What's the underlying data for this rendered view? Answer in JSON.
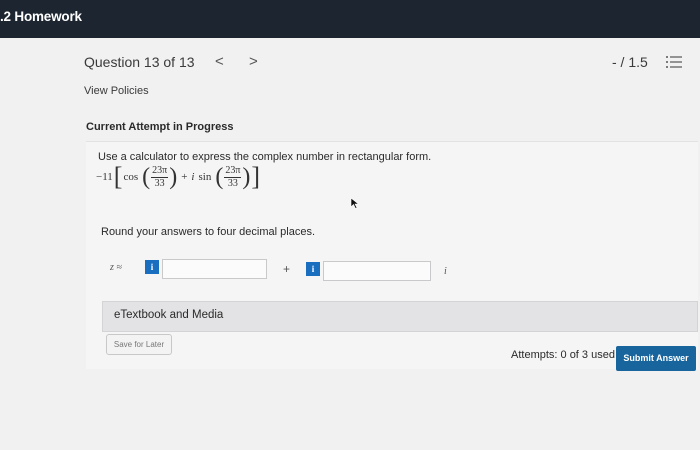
{
  "app": {
    "title": ".2 Homework"
  },
  "question_header": {
    "title": "Question 13 of 13",
    "prev_icon": "chevron-left-icon",
    "next_icon": "chevron-right-icon",
    "prev_glyph": "<",
    "next_glyph": ">",
    "score": "- / 1.5",
    "list_icon": "list-icon"
  },
  "links": {
    "view_policies": "View Policies"
  },
  "attempt": {
    "title": "Current Attempt in Progress"
  },
  "question": {
    "instruction": "Use a calculator to express the complex number in rectangular form.",
    "formula": {
      "coefficient": "−11",
      "open_bracket": "[",
      "close_bracket": "]",
      "cos": "cos",
      "sin": "sin",
      "plus": "+",
      "imag_unit": "i",
      "open_paren": "(",
      "close_paren": ")",
      "numerator": "23π",
      "denominator": "33"
    },
    "round_text": "Round your answers to four decimal places."
  },
  "answer": {
    "z_label": "z ≈",
    "info_glyph": "i",
    "real_value": "",
    "plus": "+",
    "imag_value": "",
    "imag_unit": "i"
  },
  "etextbook": {
    "label": "eTextbook and Media"
  },
  "footer": {
    "save_label": "Save for Later",
    "attempts_text": "Attempts: 0 of 3 used",
    "submit_label": "Submit Answer"
  },
  "colors": {
    "topbar": "#1d2530",
    "accent": "#17659c",
    "info_badge": "#1a6ec0"
  }
}
